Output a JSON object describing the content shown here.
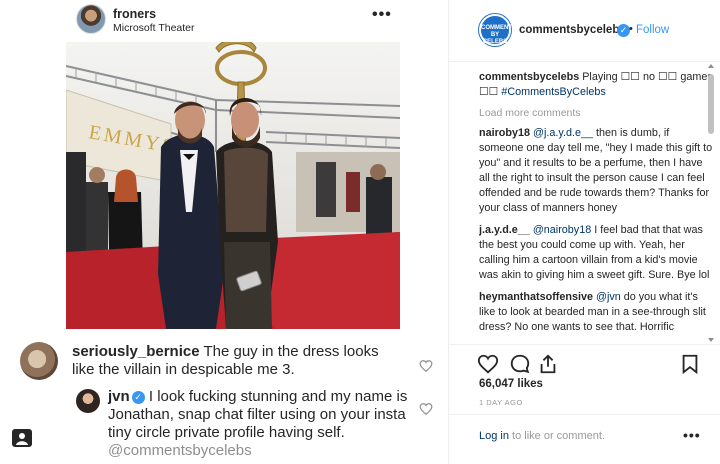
{
  "screenshot_post": {
    "username": "froners",
    "location": "Microsoft Theater",
    "more_label": "•••",
    "photo_sign_text": "EMMYS",
    "comments": [
      {
        "username": "seriously_bernice",
        "text": "The guy in the dress looks like the villain in despicable me 3."
      },
      {
        "username": "jvn",
        "text": "I look fucking stunning and my name is Jonathan, snap chat filter using on your insta tiny circle private profile having self.",
        "watermark": "@commentsbycelebs"
      }
    ]
  },
  "post": {
    "account": "commentsbycelebs",
    "avatar_text": "COMMENTS BY CELEBS",
    "separator": "•",
    "follow_label": "Follow",
    "caption_user": "commentsbycelebs",
    "caption_text": "Playing ☐☐ no ☐☐ games ☐☐",
    "caption_tag": "#CommentsByCelebs",
    "load_more": "Load more comments",
    "comments": [
      {
        "user": "nairoby18",
        "mention": "@j.a.y.d.e__",
        "text": "then is dumb, if someone one day tell me, \"hey I made this gift to you\" and it results to be a perfume, then I have all the right to insult the person cause I can feel offended and be rude towards them? Thanks for your class of manners honey"
      },
      {
        "user": "j.a.y.d.e__",
        "mention": "@nairoby18",
        "text": "I feel bad that that was the best you could come up with. Yeah, her calling him a cartoon villain from a kid's movie was akin to giving him a sweet gift. Sure. Bye lol"
      },
      {
        "user": "heymanthatsoffensive",
        "mention": "@jvn",
        "text": "do you what it's like to look at bearded man in a see-through slit dress? No one wants to see that. Horrific"
      }
    ],
    "likes": "66,047 likes",
    "time_ago": "1 DAY AGO",
    "login_link": "Log in",
    "login_rest": "to like or comment.",
    "more_label": "•••"
  },
  "colors": {
    "accent": "#3897f0",
    "link": "#003569",
    "muted": "#999999",
    "text": "#262626"
  }
}
